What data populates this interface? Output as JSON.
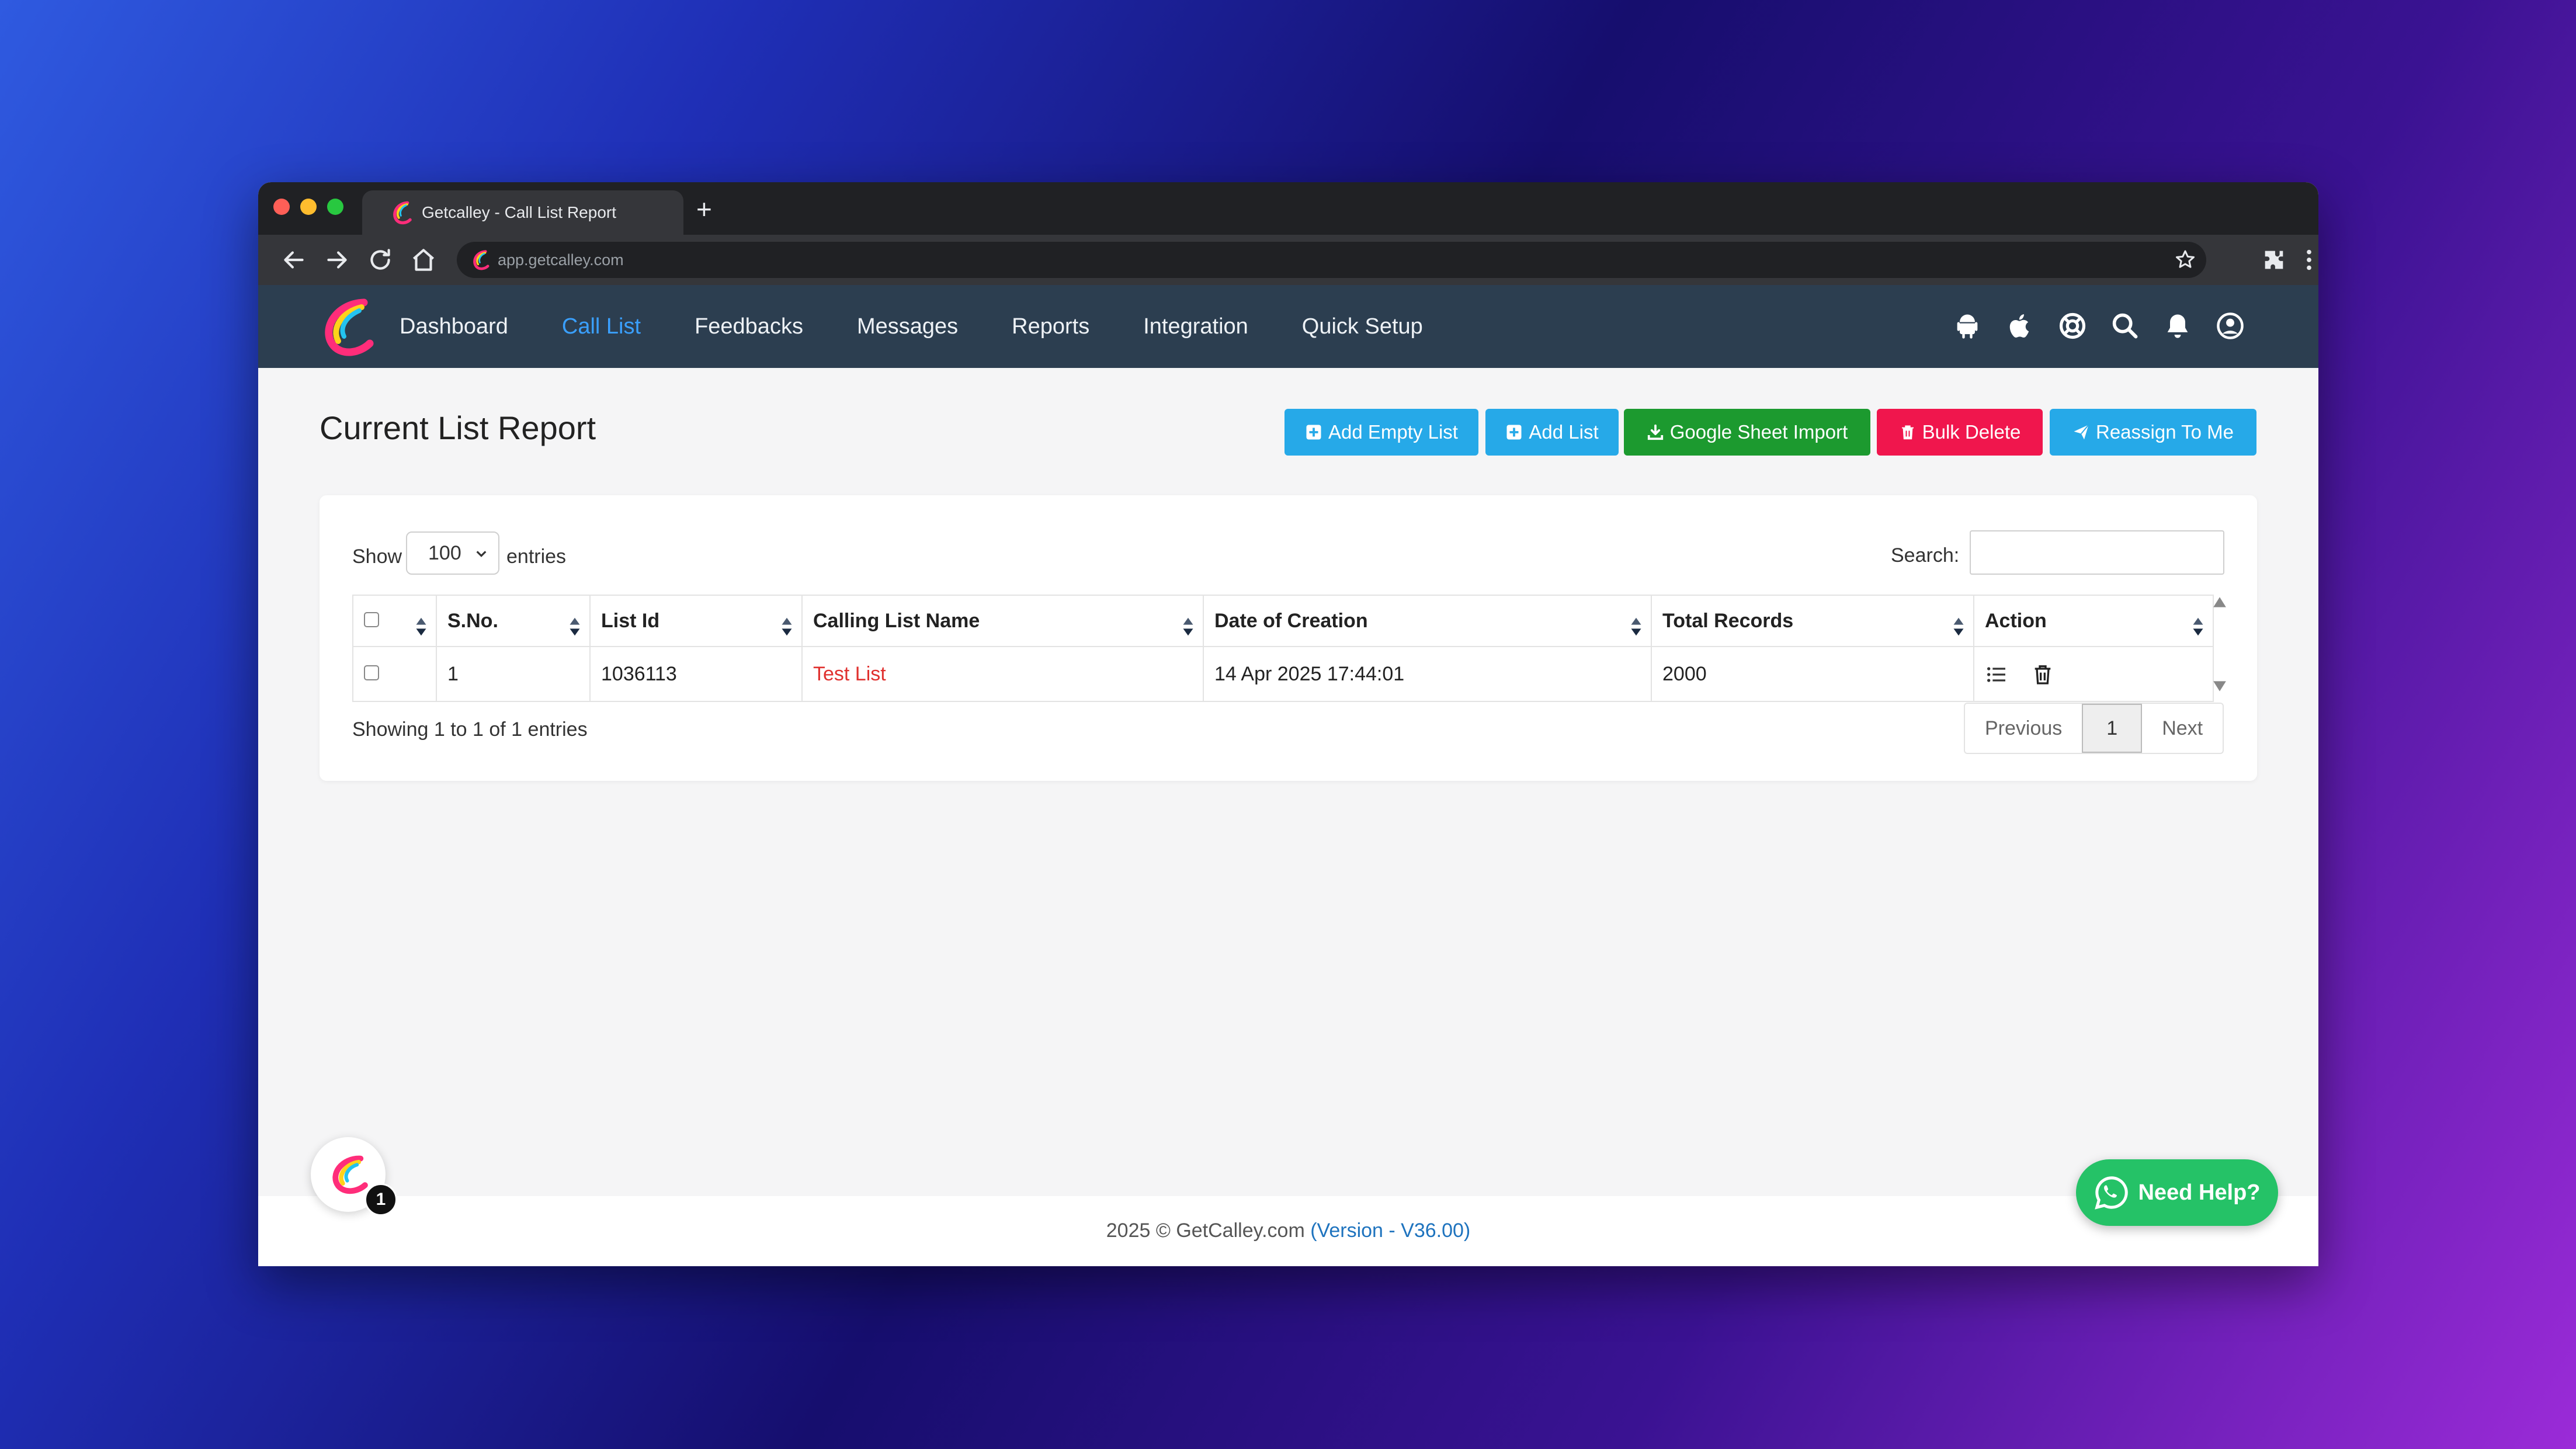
{
  "browser": {
    "tab_title": "Getcalley - Call List Report",
    "new_tab": "+",
    "url": "app.getcalley.com"
  },
  "nav": {
    "items": [
      {
        "label": "Dashboard",
        "active": false
      },
      {
        "label": "Call List",
        "active": true
      },
      {
        "label": "Feedbacks",
        "active": false
      },
      {
        "label": "Messages",
        "active": false
      },
      {
        "label": "Reports",
        "active": false
      },
      {
        "label": "Integration",
        "active": false
      },
      {
        "label": "Quick Setup",
        "active": false
      }
    ],
    "right_icons": [
      "android-icon",
      "apple-icon",
      "support-icon",
      "search-icon",
      "bell-icon",
      "user-icon"
    ]
  },
  "page": {
    "title": "Current List Report",
    "buttons": {
      "add_empty_list": "Add Empty List",
      "add_list": "Add List",
      "google_sheet_import": "Google Sheet Import",
      "bulk_delete": "Bulk Delete",
      "reassign_to_me": "Reassign To Me"
    }
  },
  "table": {
    "show_label": "Show",
    "entries_value": "100",
    "entries_label": "entries",
    "search_label": "Search:",
    "search_value": "",
    "columns": [
      "S.No.",
      "List Id",
      "Calling List Name",
      "Date of Creation",
      "Total Records",
      "Action"
    ],
    "rows": [
      {
        "sno": "1",
        "list_id": "1036113",
        "name": "Test List",
        "date": "14 Apr 2025 17:44:01",
        "total": "2000"
      }
    ],
    "info": "Showing 1 to 1 of 1 entries",
    "pager": {
      "previous": "Previous",
      "current": "1",
      "next": "Next"
    }
  },
  "footer": {
    "text": "2025 © GetCalley.com ",
    "version": "(Version - V36.00)"
  },
  "widgets": {
    "badge_count": "1",
    "help_label": "Need Help?"
  },
  "colors": {
    "navbar": "#2c3e50",
    "active_nav": "#3aa0ff",
    "btn_blue": "#26a9e8",
    "btn_green": "#1c9a2f",
    "btn_red": "#f0164d",
    "link_red": "#e0312f",
    "whatsapp": "#25c267"
  }
}
